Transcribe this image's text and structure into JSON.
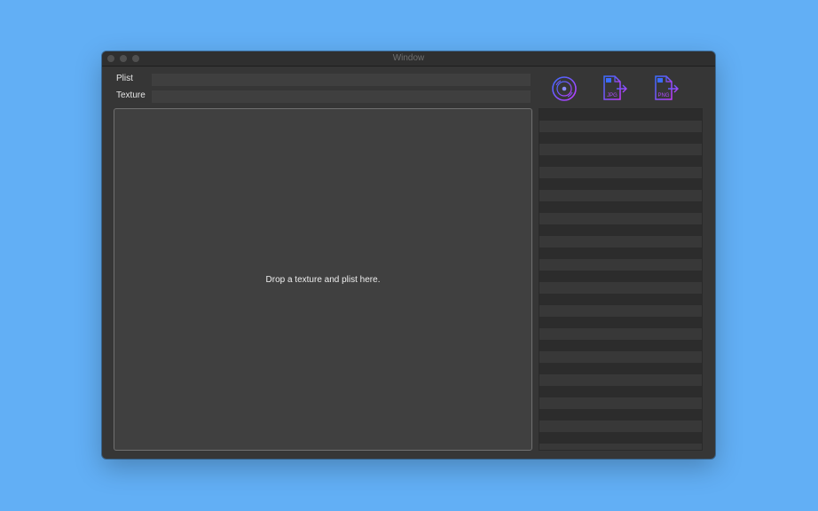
{
  "window": {
    "title": "Window"
  },
  "form": {
    "plist_label": "Plist",
    "texture_label": "Texture",
    "plist_value": "",
    "texture_value": ""
  },
  "toolbar": {
    "buttons": [
      {
        "icon": "disc-icon"
      },
      {
        "icon": "export-jpg-icon",
        "badge": "JPG"
      },
      {
        "icon": "export-png-icon",
        "badge": "PNG"
      }
    ],
    "accent_gradient": [
      "#3b6cff",
      "#c23cff"
    ]
  },
  "drop_zone": {
    "message": "Drop a texture and plist here."
  },
  "sprite_list": {
    "items": []
  }
}
